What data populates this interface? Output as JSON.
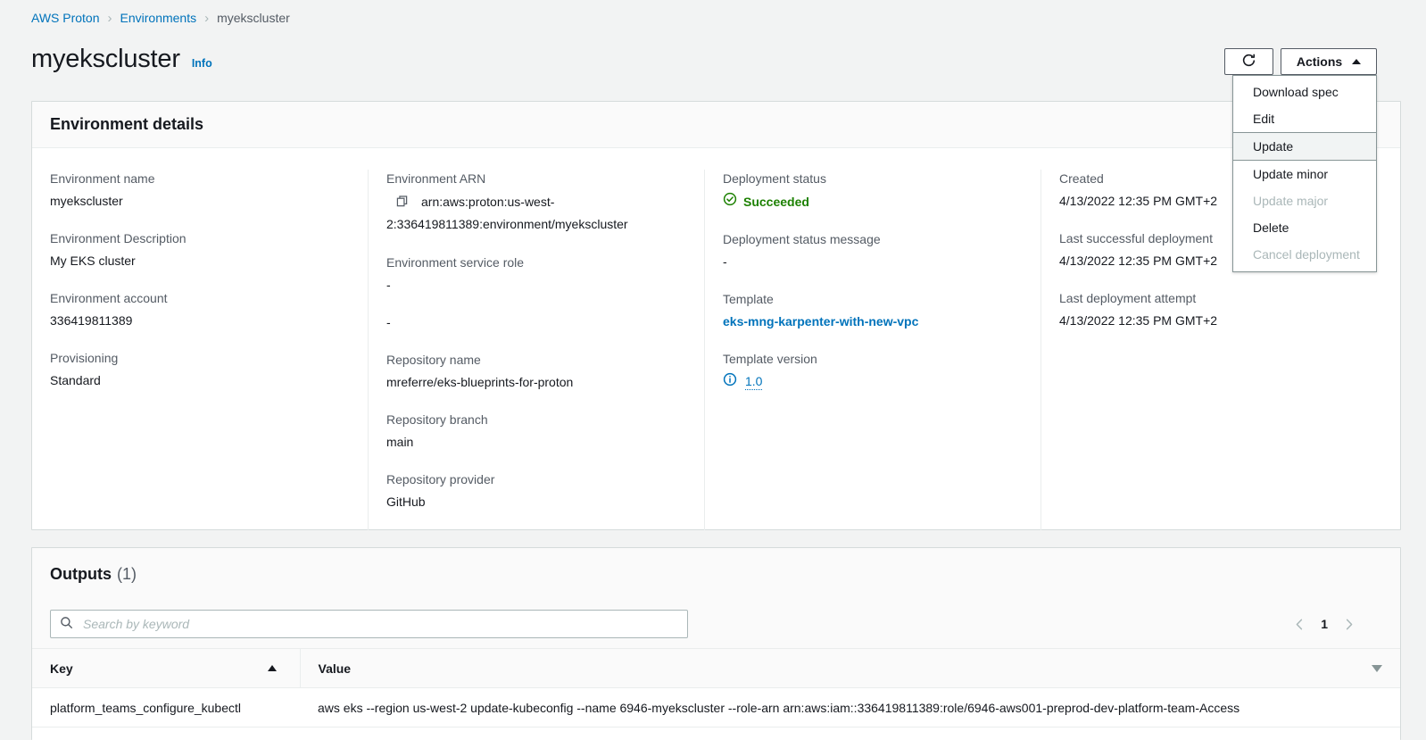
{
  "breadcrumb": {
    "items": [
      {
        "label": "AWS Proton",
        "type": "link"
      },
      {
        "label": "Environments",
        "type": "link"
      },
      {
        "label": "myekscluster",
        "type": "current"
      }
    ],
    "separator": "›"
  },
  "header": {
    "title": "myekscluster",
    "info_label": "Info",
    "refresh_icon": "refresh-icon",
    "actions_label": "Actions"
  },
  "actions_menu": {
    "items": [
      {
        "label": "Download spec",
        "state": "enabled"
      },
      {
        "label": "Edit",
        "state": "enabled"
      },
      {
        "label": "Update",
        "state": "selected"
      },
      {
        "label": "Update minor",
        "state": "enabled"
      },
      {
        "label": "Update major",
        "state": "disabled"
      },
      {
        "label": "Delete",
        "state": "enabled"
      },
      {
        "label": "Cancel deployment",
        "state": "disabled"
      }
    ]
  },
  "details": {
    "title": "Environment details",
    "col1": [
      {
        "label": "Environment name",
        "value": "myekscluster"
      },
      {
        "label": "Environment Description",
        "value": "My EKS cluster"
      },
      {
        "label": "Environment account",
        "value": "336419811389"
      },
      {
        "label": "Provisioning",
        "value": "Standard"
      }
    ],
    "arn": {
      "label": "Environment ARN",
      "value": "arn:aws:proton:us-west-2:336419811389:environment/myekscluster"
    },
    "service_role": {
      "label": "Environment service role",
      "value": "-",
      "value2": "-"
    },
    "repository": [
      {
        "label": "Repository name",
        "value": "mreferre/eks-blueprints-for-proton"
      },
      {
        "label": "Repository branch",
        "value": "main"
      },
      {
        "label": "Repository provider",
        "value": "GitHub"
      }
    ],
    "deployment_status": {
      "label": "Deployment status",
      "value": "Succeeded"
    },
    "deployment_status_message": {
      "label": "Deployment status message",
      "value": "-"
    },
    "template": {
      "label": "Template",
      "value": "eks-mng-karpenter-with-new-vpc"
    },
    "template_version": {
      "label": "Template version",
      "value": "1.0"
    },
    "timestamps": [
      {
        "label": "Created",
        "value": "4/13/2022 12:35 PM GMT+2"
      },
      {
        "label": "Last successful deployment",
        "value": "4/13/2022 12:35 PM GMT+2"
      },
      {
        "label": "Last deployment attempt",
        "value": "4/13/2022 12:35 PM GMT+2"
      }
    ]
  },
  "outputs": {
    "title": "Outputs",
    "count": "(1)",
    "search": {
      "value": "",
      "placeholder": "Search by keyword"
    },
    "pagination": {
      "page": "1"
    },
    "columns": [
      {
        "label": "Key",
        "sort": "asc"
      },
      {
        "label": "Value",
        "sort": "desc-icon"
      }
    ],
    "rows": [
      {
        "key": "platform_teams_configure_kubectl",
        "value": "aws eks --region us-west-2 update-kubeconfig --name 6946-myekscluster --role-arn arn:aws:iam::336419811389:role/6946-aws001-preprod-dev-platform-team-Access"
      }
    ]
  },
  "colors": {
    "link": "#0073bb",
    "success": "#1d8102",
    "page_bg": "#f2f3f3",
    "label": "#545b64"
  }
}
